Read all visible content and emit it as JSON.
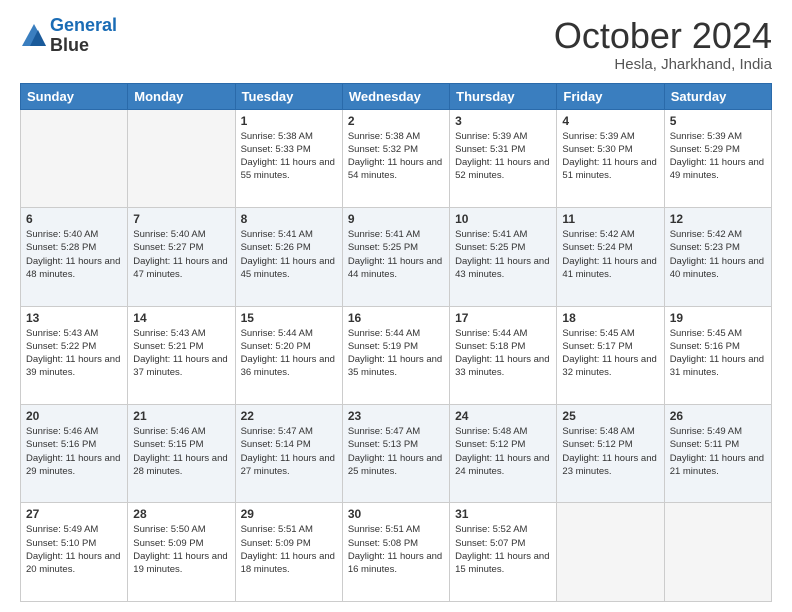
{
  "header": {
    "logo_line1": "General",
    "logo_line2": "Blue",
    "month": "October 2024",
    "location": "Hesla, Jharkhand, India"
  },
  "weekdays": [
    "Sunday",
    "Monday",
    "Tuesday",
    "Wednesday",
    "Thursday",
    "Friday",
    "Saturday"
  ],
  "weeks": [
    [
      {
        "day": "",
        "sunrise": "",
        "sunset": "",
        "daylight": ""
      },
      {
        "day": "",
        "sunrise": "",
        "sunset": "",
        "daylight": ""
      },
      {
        "day": "1",
        "sunrise": "Sunrise: 5:38 AM",
        "sunset": "Sunset: 5:33 PM",
        "daylight": "Daylight: 11 hours and 55 minutes."
      },
      {
        "day": "2",
        "sunrise": "Sunrise: 5:38 AM",
        "sunset": "Sunset: 5:32 PM",
        "daylight": "Daylight: 11 hours and 54 minutes."
      },
      {
        "day": "3",
        "sunrise": "Sunrise: 5:39 AM",
        "sunset": "Sunset: 5:31 PM",
        "daylight": "Daylight: 11 hours and 52 minutes."
      },
      {
        "day": "4",
        "sunrise": "Sunrise: 5:39 AM",
        "sunset": "Sunset: 5:30 PM",
        "daylight": "Daylight: 11 hours and 51 minutes."
      },
      {
        "day": "5",
        "sunrise": "Sunrise: 5:39 AM",
        "sunset": "Sunset: 5:29 PM",
        "daylight": "Daylight: 11 hours and 49 minutes."
      }
    ],
    [
      {
        "day": "6",
        "sunrise": "Sunrise: 5:40 AM",
        "sunset": "Sunset: 5:28 PM",
        "daylight": "Daylight: 11 hours and 48 minutes."
      },
      {
        "day": "7",
        "sunrise": "Sunrise: 5:40 AM",
        "sunset": "Sunset: 5:27 PM",
        "daylight": "Daylight: 11 hours and 47 minutes."
      },
      {
        "day": "8",
        "sunrise": "Sunrise: 5:41 AM",
        "sunset": "Sunset: 5:26 PM",
        "daylight": "Daylight: 11 hours and 45 minutes."
      },
      {
        "day": "9",
        "sunrise": "Sunrise: 5:41 AM",
        "sunset": "Sunset: 5:25 PM",
        "daylight": "Daylight: 11 hours and 44 minutes."
      },
      {
        "day": "10",
        "sunrise": "Sunrise: 5:41 AM",
        "sunset": "Sunset: 5:25 PM",
        "daylight": "Daylight: 11 hours and 43 minutes."
      },
      {
        "day": "11",
        "sunrise": "Sunrise: 5:42 AM",
        "sunset": "Sunset: 5:24 PM",
        "daylight": "Daylight: 11 hours and 41 minutes."
      },
      {
        "day": "12",
        "sunrise": "Sunrise: 5:42 AM",
        "sunset": "Sunset: 5:23 PM",
        "daylight": "Daylight: 11 hours and 40 minutes."
      }
    ],
    [
      {
        "day": "13",
        "sunrise": "Sunrise: 5:43 AM",
        "sunset": "Sunset: 5:22 PM",
        "daylight": "Daylight: 11 hours and 39 minutes."
      },
      {
        "day": "14",
        "sunrise": "Sunrise: 5:43 AM",
        "sunset": "Sunset: 5:21 PM",
        "daylight": "Daylight: 11 hours and 37 minutes."
      },
      {
        "day": "15",
        "sunrise": "Sunrise: 5:44 AM",
        "sunset": "Sunset: 5:20 PM",
        "daylight": "Daylight: 11 hours and 36 minutes."
      },
      {
        "day": "16",
        "sunrise": "Sunrise: 5:44 AM",
        "sunset": "Sunset: 5:19 PM",
        "daylight": "Daylight: 11 hours and 35 minutes."
      },
      {
        "day": "17",
        "sunrise": "Sunrise: 5:44 AM",
        "sunset": "Sunset: 5:18 PM",
        "daylight": "Daylight: 11 hours and 33 minutes."
      },
      {
        "day": "18",
        "sunrise": "Sunrise: 5:45 AM",
        "sunset": "Sunset: 5:17 PM",
        "daylight": "Daylight: 11 hours and 32 minutes."
      },
      {
        "day": "19",
        "sunrise": "Sunrise: 5:45 AM",
        "sunset": "Sunset: 5:16 PM",
        "daylight": "Daylight: 11 hours and 31 minutes."
      }
    ],
    [
      {
        "day": "20",
        "sunrise": "Sunrise: 5:46 AM",
        "sunset": "Sunset: 5:16 PM",
        "daylight": "Daylight: 11 hours and 29 minutes."
      },
      {
        "day": "21",
        "sunrise": "Sunrise: 5:46 AM",
        "sunset": "Sunset: 5:15 PM",
        "daylight": "Daylight: 11 hours and 28 minutes."
      },
      {
        "day": "22",
        "sunrise": "Sunrise: 5:47 AM",
        "sunset": "Sunset: 5:14 PM",
        "daylight": "Daylight: 11 hours and 27 minutes."
      },
      {
        "day": "23",
        "sunrise": "Sunrise: 5:47 AM",
        "sunset": "Sunset: 5:13 PM",
        "daylight": "Daylight: 11 hours and 25 minutes."
      },
      {
        "day": "24",
        "sunrise": "Sunrise: 5:48 AM",
        "sunset": "Sunset: 5:12 PM",
        "daylight": "Daylight: 11 hours and 24 minutes."
      },
      {
        "day": "25",
        "sunrise": "Sunrise: 5:48 AM",
        "sunset": "Sunset: 5:12 PM",
        "daylight": "Daylight: 11 hours and 23 minutes."
      },
      {
        "day": "26",
        "sunrise": "Sunrise: 5:49 AM",
        "sunset": "Sunset: 5:11 PM",
        "daylight": "Daylight: 11 hours and 21 minutes."
      }
    ],
    [
      {
        "day": "27",
        "sunrise": "Sunrise: 5:49 AM",
        "sunset": "Sunset: 5:10 PM",
        "daylight": "Daylight: 11 hours and 20 minutes."
      },
      {
        "day": "28",
        "sunrise": "Sunrise: 5:50 AM",
        "sunset": "Sunset: 5:09 PM",
        "daylight": "Daylight: 11 hours and 19 minutes."
      },
      {
        "day": "29",
        "sunrise": "Sunrise: 5:51 AM",
        "sunset": "Sunset: 5:09 PM",
        "daylight": "Daylight: 11 hours and 18 minutes."
      },
      {
        "day": "30",
        "sunrise": "Sunrise: 5:51 AM",
        "sunset": "Sunset: 5:08 PM",
        "daylight": "Daylight: 11 hours and 16 minutes."
      },
      {
        "day": "31",
        "sunrise": "Sunrise: 5:52 AM",
        "sunset": "Sunset: 5:07 PM",
        "daylight": "Daylight: 11 hours and 15 minutes."
      },
      {
        "day": "",
        "sunrise": "",
        "sunset": "",
        "daylight": ""
      },
      {
        "day": "",
        "sunrise": "",
        "sunset": "",
        "daylight": ""
      }
    ]
  ]
}
